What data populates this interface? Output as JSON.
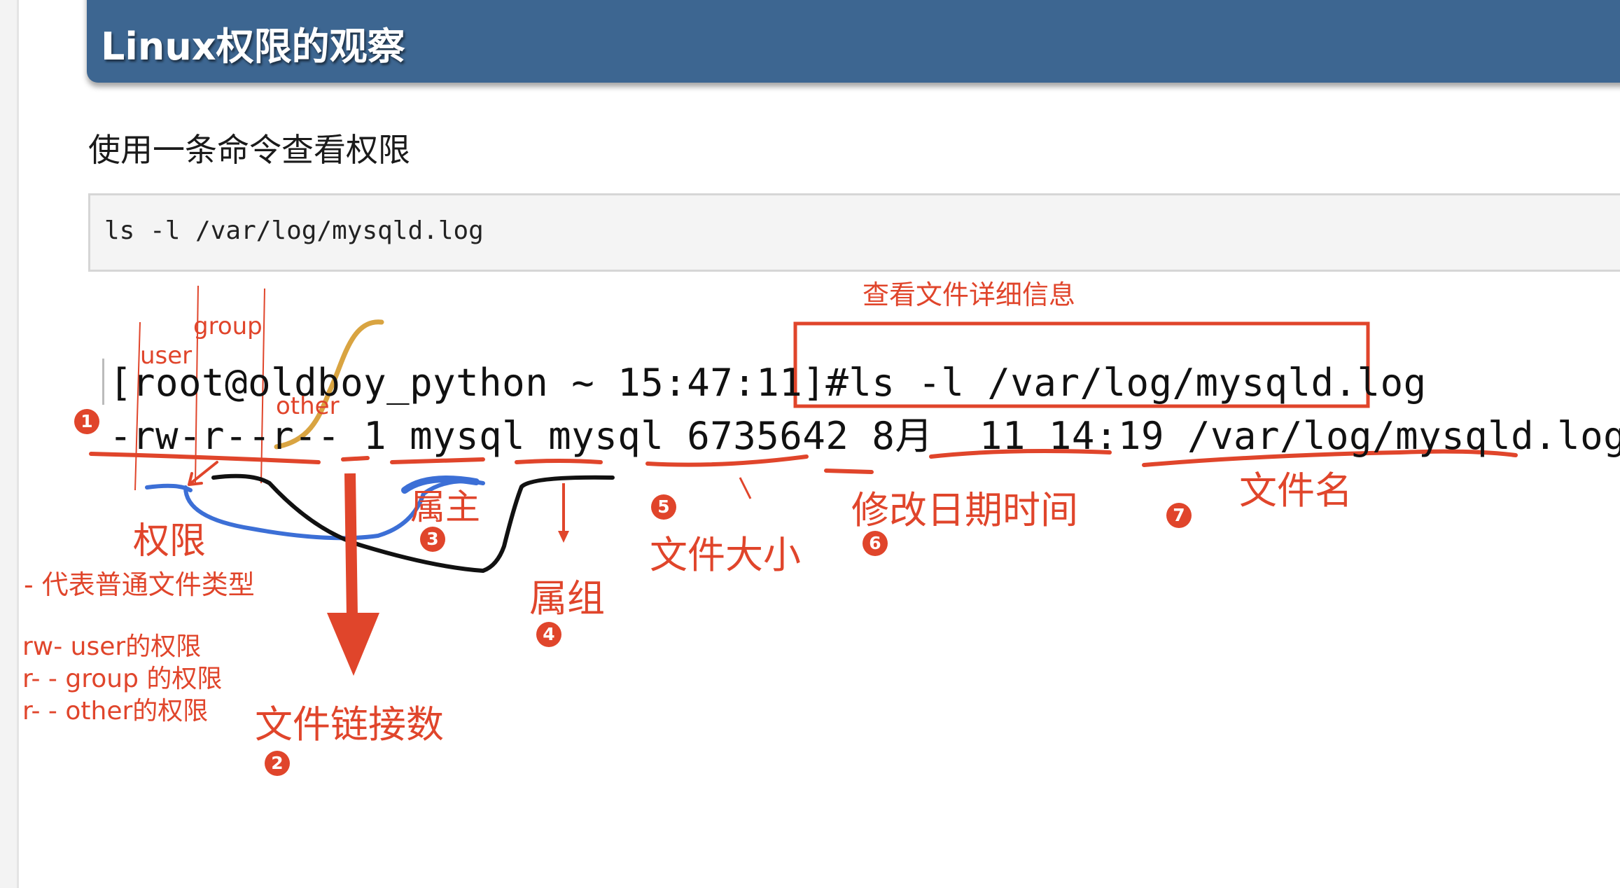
{
  "header": {
    "title": "Linux权限的观察"
  },
  "section": {
    "subtitle": "使用一条命令查看权限"
  },
  "code": {
    "command": "ls -l /var/log/mysqld.log"
  },
  "terminal": {
    "prompt_line": "[root@oldboy_python ~ 15:47:11]#ls -l /var/log/mysqld.log",
    "output_line": "-rw-r--r-- 1 mysql mysql 6735642 8月  11 14:19 /var/log/mysqld.log"
  },
  "annotations": {
    "detail_box_label": "查看文件详细信息",
    "user": "user",
    "group": "group",
    "other": "other",
    "permission": "权限",
    "file_type_note": "-  代表普通文件类型",
    "perm_notes": [
      "rw-  user的权限",
      "r- -   group  的权限",
      "r- -    other的权限"
    ],
    "link_count": "文件链接数",
    "owner": "属主",
    "group_owner": "属组",
    "size": "文件大小",
    "mtime": "修改日期时间",
    "filename": "文件名",
    "badges": [
      "1",
      "2",
      "3",
      "4",
      "5",
      "6",
      "7"
    ]
  },
  "colors": {
    "header_bg": "#3d6691",
    "annotation_red": "#e0452b",
    "blue_mark": "#3c6fd6",
    "gold_mark": "#d9a441",
    "black_mark": "#111111"
  }
}
